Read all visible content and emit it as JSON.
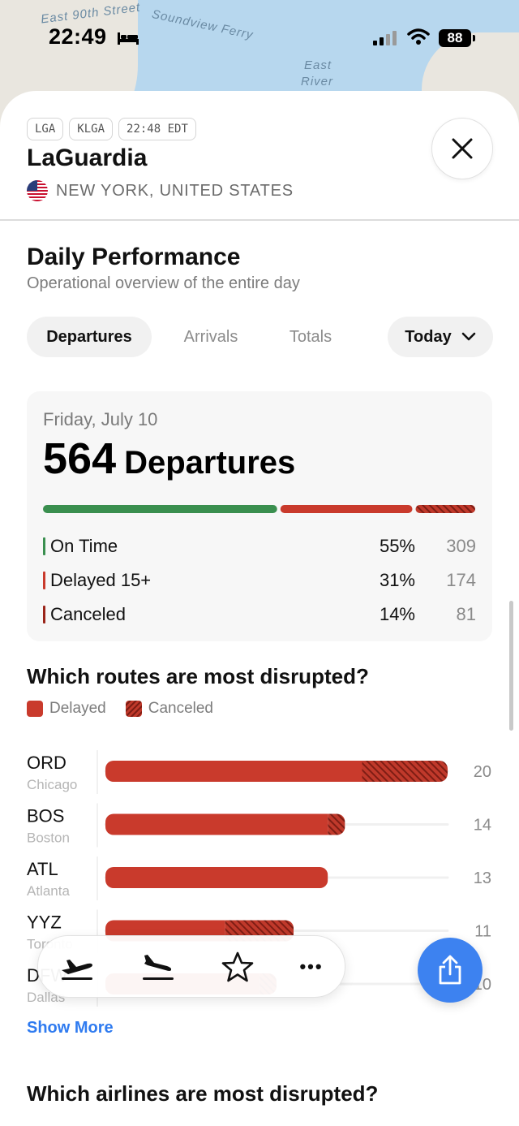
{
  "status_bar": {
    "time": "22:49",
    "battery": "88"
  },
  "map": {
    "labels": [
      "East 90th Street",
      "Soundview Ferry",
      "East",
      "River"
    ]
  },
  "header": {
    "tags": [
      "LGA",
      "KLGA",
      "22:48 EDT"
    ],
    "airport_name": "LaGuardia",
    "location": "NEW YORK, UNITED STATES"
  },
  "performance": {
    "title": "Daily Performance",
    "subtitle": "Operational overview of the entire day",
    "tabs": [
      "Departures",
      "Arrivals",
      "Totals"
    ],
    "active_tab": "Departures",
    "period": "Today"
  },
  "summary": {
    "date": "Friday, July 10",
    "count": "564",
    "count_label": "Departures",
    "breakdown": [
      {
        "label": "On Time",
        "percent": "55%",
        "count": "309",
        "fraction": 0.55,
        "color": "#3a8f4f"
      },
      {
        "label": "Delayed 15+",
        "percent": "31%",
        "count": "174",
        "fraction": 0.31,
        "color": "#c93a2c"
      },
      {
        "label": "Canceled",
        "percent": "14%",
        "count": "81",
        "fraction": 0.14,
        "color": "#9a2419"
      }
    ]
  },
  "routes": {
    "title": "Which routes are most disrupted?",
    "legend": [
      "Delayed",
      "Canceled"
    ],
    "show_more": "Show More"
  },
  "chart_data": {
    "type": "bar",
    "orientation": "horizontal",
    "stacked": true,
    "categories": [
      "ORD",
      "BOS",
      "ATL",
      "YYZ",
      "DFW"
    ],
    "category_sublabels": [
      "Chicago",
      "Boston",
      "Atlanta",
      "Toronto",
      "Dallas"
    ],
    "series": [
      {
        "name": "Delayed",
        "values": [
          15,
          13,
          13,
          7,
          9
        ]
      },
      {
        "name": "Canceled",
        "values": [
          5,
          1,
          0,
          4,
          1
        ]
      }
    ],
    "totals": [
      20,
      14,
      13,
      11,
      10
    ],
    "xlim": [
      0,
      20
    ],
    "legend_position": "top-left"
  },
  "colors": {
    "accent": "#3d82f0",
    "delayed": "#c93a2c",
    "on_time": "#3a8f4f",
    "canceled": "#9a2419"
  },
  "tabbar": {
    "icons": [
      "departures-icon",
      "arrivals-icon",
      "favorites-icon",
      "more-icon"
    ],
    "more_label": "•••"
  },
  "airlines": {
    "title": "Which airlines are most disrupted?"
  }
}
